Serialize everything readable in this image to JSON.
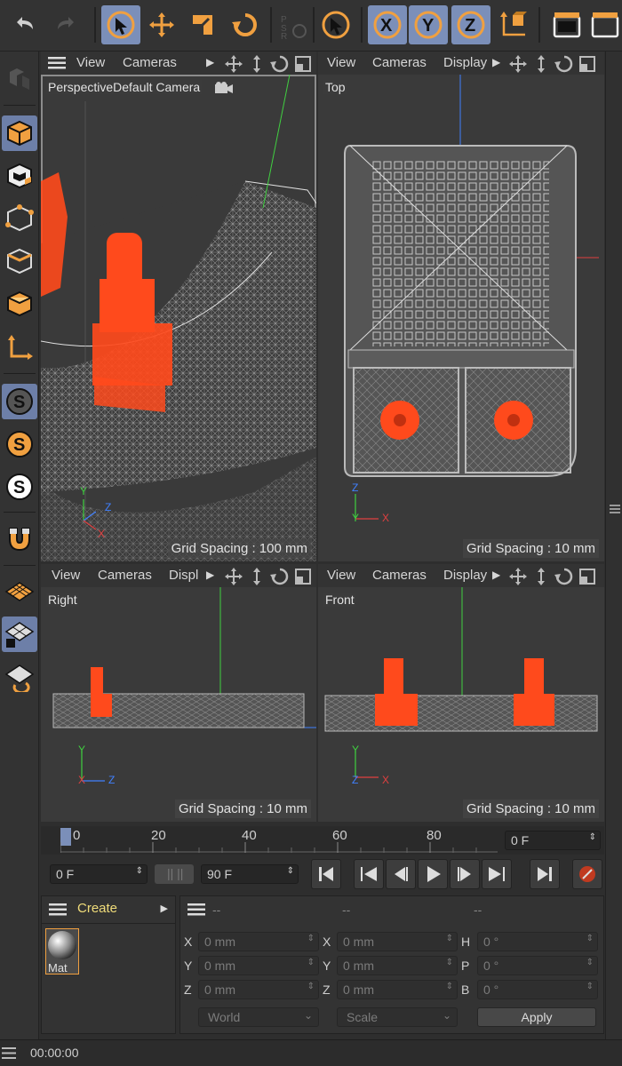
{
  "viewports": {
    "perspective": {
      "menus": [
        "View",
        "Cameras"
      ],
      "label": "PerspectiveDefault Camera",
      "grid": "Grid Spacing : 100 mm"
    },
    "top": {
      "menus": [
        "View",
        "Cameras",
        "Display"
      ],
      "label": "Top",
      "grid": "Grid Spacing : 10 mm"
    },
    "right": {
      "menus": [
        "View",
        "Cameras",
        "Displ"
      ],
      "label": "Right",
      "grid": "Grid Spacing : 10 mm"
    },
    "front": {
      "menus": [
        "View",
        "Cameras",
        "Display"
      ],
      "label": "Front",
      "grid": "Grid Spacing : 10 mm"
    }
  },
  "axes": {
    "x": "X",
    "y": "Y",
    "z": "Z"
  },
  "timeline": {
    "ticks": [
      "0",
      "20",
      "40",
      "60",
      "80"
    ],
    "current_frame": "0 F",
    "start_frame": "0 F",
    "end_frame": "90 F"
  },
  "material_panel": {
    "create_label": "Create",
    "material_name": "Mat"
  },
  "attributes": {
    "headers": [
      "--",
      "--",
      "--"
    ],
    "pos_labels": [
      "X",
      "Y",
      "Z"
    ],
    "size_labels": [
      "X",
      "Y",
      "Z"
    ],
    "rot_labels": [
      "H",
      "P",
      "B"
    ],
    "pos_values": [
      "0 mm",
      "0 mm",
      "0 mm"
    ],
    "size_values": [
      "0 mm",
      "0 mm",
      "0 mm"
    ],
    "rot_values": [
      "0 °",
      "0 °",
      "0 °"
    ],
    "coord_system": "World",
    "mode": "Scale",
    "apply_label": "Apply"
  },
  "status": {
    "time": "00:00:00"
  },
  "colors": {
    "accent": "#f0a040",
    "active_tool": "#7b8fb9",
    "model_orange": "#ff4a1c",
    "axis_x": "#e04040",
    "axis_y": "#40d040",
    "axis_z": "#4080ff"
  }
}
